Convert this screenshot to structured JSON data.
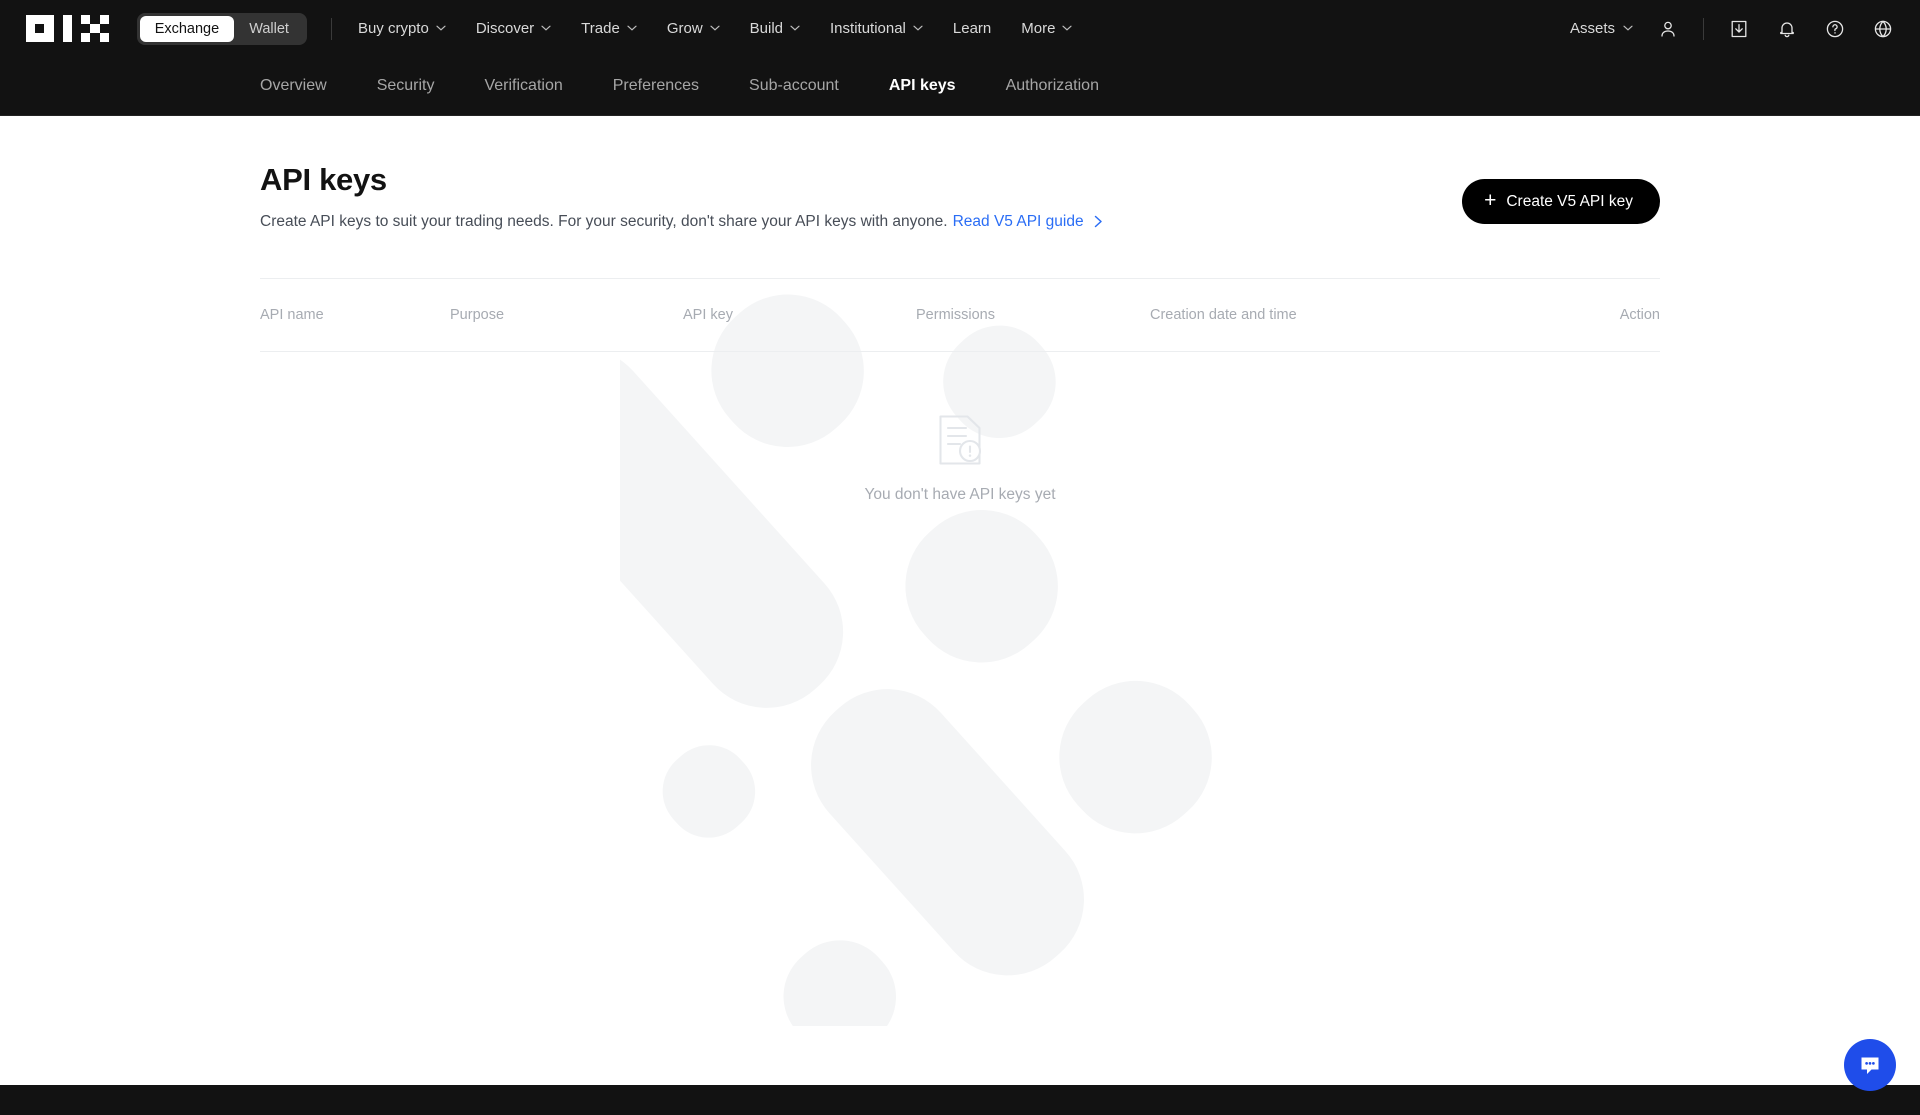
{
  "brand": {
    "logo_name": "okx-logo",
    "accent": "#1f4dea",
    "dark": "#121212"
  },
  "topnav": {
    "segmented": {
      "options": [
        "Exchange",
        "Wallet"
      ],
      "selected": "Exchange"
    },
    "links": [
      {
        "label": "Buy crypto",
        "has_chevron": true
      },
      {
        "label": "Discover",
        "has_chevron": true
      },
      {
        "label": "Trade",
        "has_chevron": true
      },
      {
        "label": "Grow",
        "has_chevron": true
      },
      {
        "label": "Build",
        "has_chevron": true
      },
      {
        "label": "Institutional",
        "has_chevron": true
      },
      {
        "label": "Learn",
        "has_chevron": false
      },
      {
        "label": "More",
        "has_chevron": true
      }
    ],
    "assets_label": "Assets",
    "icons": [
      "user-icon",
      "download-icon",
      "bell-icon",
      "help-icon",
      "globe-icon"
    ]
  },
  "subnav": {
    "tabs": [
      {
        "label": "Overview",
        "active": false
      },
      {
        "label": "Security",
        "active": false
      },
      {
        "label": "Verification",
        "active": false
      },
      {
        "label": "Preferences",
        "active": false
      },
      {
        "label": "Sub-account",
        "active": false
      },
      {
        "label": "API keys",
        "active": true
      },
      {
        "label": "Authorization",
        "active": false
      }
    ]
  },
  "main": {
    "title": "API keys",
    "description": "Create API keys to suit your trading needs. For your security, don't share your API keys with anyone.",
    "guide_link": "Read V5 API guide",
    "create_button": "Create V5 API key",
    "create_button_icon": "plus-icon",
    "table": {
      "columns": [
        "API name",
        "Purpose",
        "API key",
        "Permissions",
        "Creation date and time",
        "Action"
      ],
      "rows": []
    },
    "empty_state": {
      "icon": "document-alert-icon",
      "message": "You don't have API keys yet"
    }
  },
  "chat": {
    "icon": "chat-bubble-icon",
    "color": "#1f4dea"
  }
}
